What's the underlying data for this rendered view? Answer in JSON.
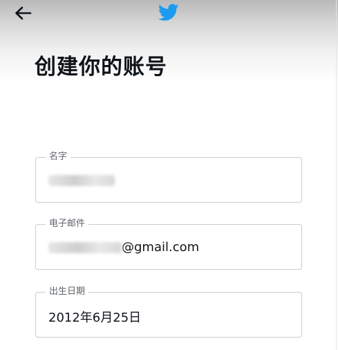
{
  "header": {
    "back_icon": "arrow-left-icon",
    "logo_icon": "twitter-bird-icon",
    "brand_color": "#1d9bf0"
  },
  "page": {
    "title": "创建你的账号"
  },
  "form": {
    "name_label": "名字",
    "email_label": "电子邮件",
    "email_suffix": "@gmail.com",
    "birthdate_label": "出生日期",
    "birthdate_value": "2012年6月25日"
  }
}
